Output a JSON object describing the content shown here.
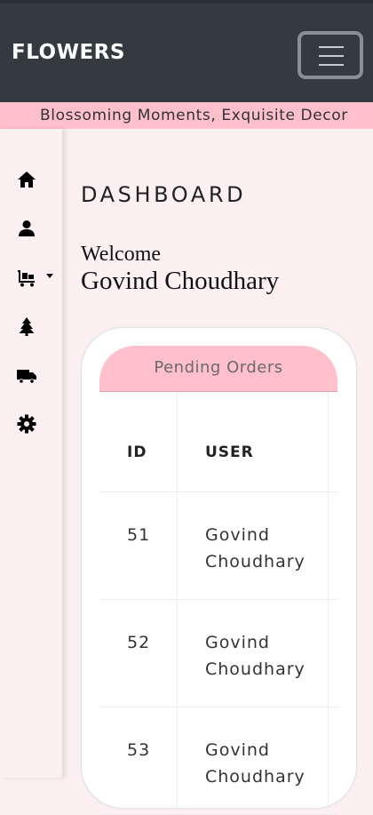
{
  "navbar": {
    "brand": "FLOWERS",
    "toggle_icon": "hamburger-menu-icon"
  },
  "marquee": {
    "text": "Blossoming Moments, Exquisite Decor"
  },
  "sidebar": {
    "items": [
      {
        "icon": "home-icon"
      },
      {
        "icon": "user-icon"
      },
      {
        "icon": "cart-dropdown-icon"
      },
      {
        "icon": "tree-icon"
      },
      {
        "icon": "delivery-truck-icon"
      },
      {
        "icon": "gear-icon"
      }
    ]
  },
  "main": {
    "title": "DASHBOARD",
    "welcome": "Welcome",
    "user_name": "Govind Choudhary"
  },
  "orders": {
    "title": "Pending Orders",
    "columns": [
      "ID",
      "USER"
    ],
    "rows": [
      {
        "id": "51",
        "user": "Govind Choudhary"
      },
      {
        "id": "52",
        "user": "Govind Choudhary"
      },
      {
        "id": "53",
        "user": "Govind Choudhary"
      }
    ]
  },
  "colors": {
    "navbar": "#343a40",
    "accent_pink": "#ffc0cb",
    "page_background": "#fcf0f2"
  }
}
